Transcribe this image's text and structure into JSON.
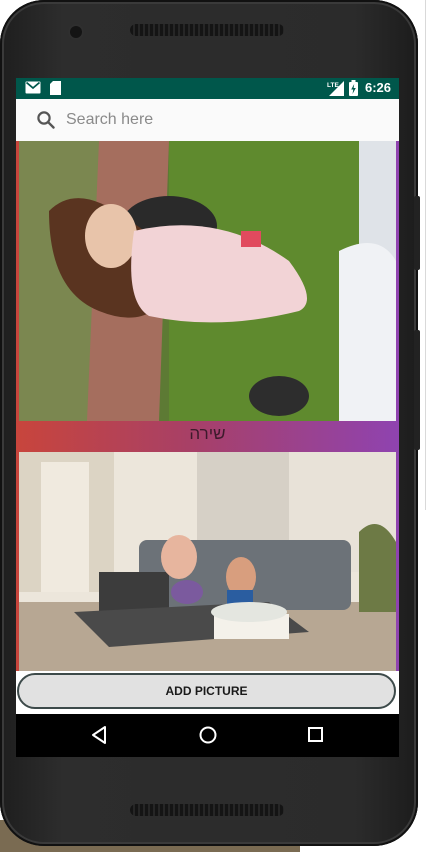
{
  "status_bar": {
    "time": "6:26",
    "network": "LTE",
    "icons": [
      "gmail-icon",
      "sd-card-icon",
      "signal-icon",
      "battery-charging-icon"
    ]
  },
  "search": {
    "placeholder": "Search here",
    "value": ""
  },
  "gallery": {
    "items": [
      {
        "caption": "שירה"
      },
      {
        "caption": ""
      }
    ]
  },
  "actions": {
    "add_picture_label": "ADD PICTURE"
  },
  "navigation": {
    "buttons": [
      "back-icon",
      "home-icon",
      "recents-icon"
    ]
  },
  "colors": {
    "status_bar": "#00574b",
    "card_gradient_start": "#c8453c",
    "card_gradient_end": "#8f43b0",
    "button_bg": "#e1e1e1"
  }
}
